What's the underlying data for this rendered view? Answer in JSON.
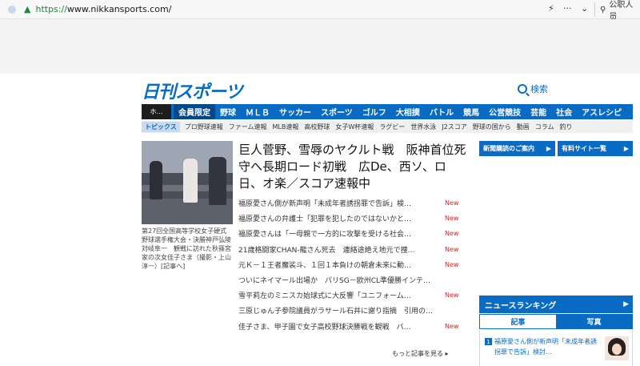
{
  "browser": {
    "url_scheme": "https://",
    "url_rest": "www.nikkansports.com/",
    "more_label": "···",
    "search_label": "公职人员"
  },
  "header": {
    "logo": "日刊スポーツ",
    "search_label": "検索"
  },
  "nav": {
    "home": "ホ…",
    "items": [
      "会員限定",
      "野球",
      "ＭＬＢ",
      "サッカー",
      "スポーツ",
      "ゴルフ",
      "大相撲",
      "バトル",
      "競馬",
      "公営競技",
      "芸能",
      "社会",
      "アスレシピ"
    ]
  },
  "topics": {
    "label": "トピックス",
    "items": [
      "プロ野球速報",
      "ファーム速報",
      "MLB速報",
      "高校野球",
      "女子W杯速報",
      "ラグビー",
      "世界水泳",
      "J2スコア",
      "野球の国から",
      "動画",
      "コラム",
      "釣り"
    ]
  },
  "main": {
    "caption": "第27回全国高等学校女子硬式野球選手権大会・決勝神戸弘陵対岐阜一　観戦に訪れた秋篠宮家の次女佳子さま（撮影・上山淳一）[記事へ]",
    "headline": "巨人菅野、雪辱のヤクルト戦　阪神首位死守へ長期ロード初戦　広De、西ソ、ロ日、オ楽／スコア速報中",
    "new_label": "New",
    "news": [
      {
        "text": "福原愛さん側が新声明「未成年者誘拐罪で告訴」検…",
        "new": true
      },
      {
        "text": "福原愛さんの弁護士「犯罪を犯したのではないかと…",
        "new": true
      },
      {
        "text": "福原愛さんは「一母親で一方的に攻撃を受ける社会…",
        "new": true
      },
      {
        "text": "21歳格闘家CHAN-龍さん死去　連絡途絶え地元で捜…",
        "new": true
      },
      {
        "text": "元Ｋ－１王者魔裟斗、１回１本負けの朝倉未来に動…",
        "new": true
      },
      {
        "text": "ついにネイマール出場か　パリSG－欧州CL準優勝インテ…",
        "new": false
      },
      {
        "text": "雪平莉左のミニスカ始球式に大反響「ユニフォーム…",
        "new": true
      },
      {
        "text": "三原じゅん子参院議員がラサール石井に謝り指摘　引用の…",
        "new": false
      },
      {
        "text": "佳子さま、甲子園で女子高校野球決勝戦を観戦　バ…",
        "new": true
      }
    ],
    "more": "もっと記事を見る ▸"
  },
  "side": {
    "subscribe": "新聞購読のご案内",
    "paid": "有料サイト一覧",
    "ranking_title": "ニュースランキング",
    "tab_articles": "記事",
    "tab_photos": "写真",
    "rank1_num": "1",
    "rank1_text": "福原愛さん側が新声明「未成年者誘拐罪で告訴」検討…"
  },
  "colors": {
    "brand": "#0a6bc4",
    "nav_lead": "#05488a",
    "new": "#e02020"
  }
}
